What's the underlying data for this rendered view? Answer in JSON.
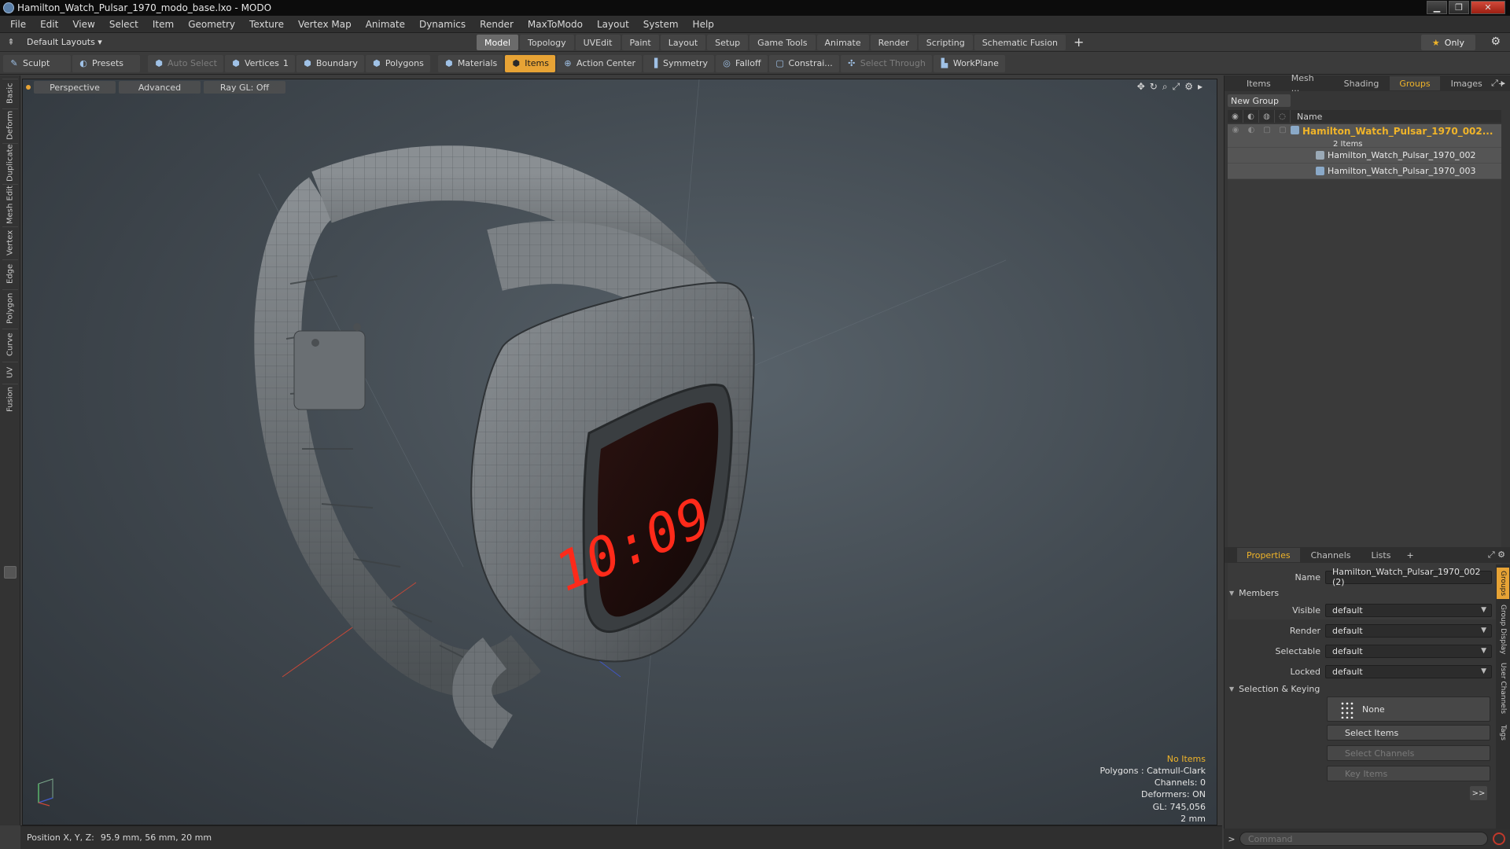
{
  "window": {
    "title": "Hamilton_Watch_Pulsar_1970_modo_base.lxo - MODO",
    "min": "▁",
    "max": "❐",
    "close": "✕"
  },
  "menu": [
    "File",
    "Edit",
    "View",
    "Select",
    "Item",
    "Geometry",
    "Texture",
    "Vertex Map",
    "Animate",
    "Dynamics",
    "Render",
    "MaxToModo",
    "Layout",
    "System",
    "Help"
  ],
  "layout": {
    "toggle": "⇞",
    "select_label": "Default Layouts ▾",
    "tabs": [
      "Model",
      "Topology",
      "UVEdit",
      "Paint",
      "Layout",
      "Setup",
      "Game Tools",
      "Animate",
      "Render",
      "Scripting",
      "Schematic Fusion"
    ],
    "active_tab": "Model",
    "add": "+",
    "only_label": "Only",
    "star": "★",
    "gear": "⚙"
  },
  "toolbar": {
    "sculpt": "Sculpt",
    "presets": "Presets",
    "auto_select": "Auto Select",
    "vertices": "Vertices",
    "vertices_count": "1",
    "boundary": "Boundary",
    "polygons": "Polygons",
    "materials": "Materials",
    "items": "Items",
    "action_center": "Action Center",
    "symmetry": "Symmetry",
    "falloff": "Falloff",
    "constraints": "Constrai...",
    "select_through": "Select Through",
    "workplane": "WorkPlane"
  },
  "left_tabs": [
    "Basic",
    "Deform",
    "Duplicate",
    "Mesh Edit",
    "Vertex",
    "Edge",
    "Polygon",
    "Curve",
    "UV",
    "Fusion"
  ],
  "viewport": {
    "perspective": "Perspective",
    "advanced": "Advanced",
    "raygl": "Ray GL: Off",
    "display_time": "10:09",
    "info": {
      "items": "No Items",
      "polygons": "Polygons : Catmull-Clark",
      "channels": "Channels: 0",
      "deformers": "Deformers: ON",
      "gl": "GL: 745,056",
      "scale": "2 mm"
    }
  },
  "status": {
    "label": "Position X, Y, Z:",
    "value": "95.9 mm, 56 mm, 20 mm"
  },
  "groups_panel": {
    "tabs": [
      "Items",
      "Mesh ...",
      "Shading",
      "Groups",
      "Images"
    ],
    "active_tab": "Groups",
    "new_group": "New Group",
    "column_name": "Name",
    "group_name": "Hamilton_Watch_Pulsar_1970_002...",
    "group_count": "2 Items",
    "children": [
      "Hamilton_Watch_Pulsar_1970_002",
      "Hamilton_Watch_Pulsar_1970_003"
    ]
  },
  "properties": {
    "tabs": [
      "Properties",
      "Channels",
      "Lists"
    ],
    "active_tab": "Properties",
    "name_label": "Name",
    "name_value": "Hamilton_Watch_Pulsar_1970_002 (2)",
    "members": "Members",
    "fields": [
      {
        "label": "Visible",
        "value": "default"
      },
      {
        "label": "Render",
        "value": "default"
      },
      {
        "label": "Selectable",
        "value": "default"
      },
      {
        "label": "Locked",
        "value": "default"
      }
    ],
    "selection_keying": "Selection & Keying",
    "none": "None",
    "select_items": "Select Items",
    "select_channels": "Select Channels",
    "key_items": "Key Items",
    "more": ">>",
    "side_tabs": [
      "Groups",
      "Group Display",
      "User Channels",
      "Tags"
    ]
  },
  "command": {
    "placeholder": "Command",
    "arrow": ">"
  },
  "colors": {
    "accent": "#e7a335",
    "highlight_text": "#f0b429",
    "led_red": "#ff2a1a"
  }
}
